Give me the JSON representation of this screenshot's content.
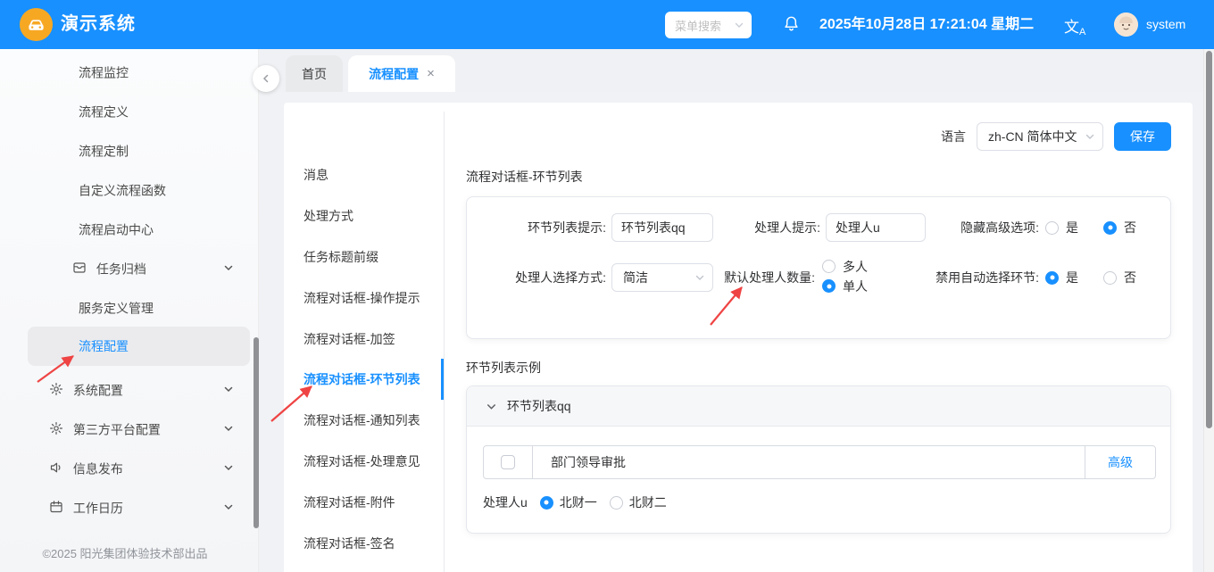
{
  "colors": {
    "accent": "#1890ff",
    "header_bg": "#1890ff",
    "logo_bg": "#f7a823",
    "arrow": "#ef4444",
    "active_menu_bg": "#ebebed"
  },
  "header": {
    "app_title": "演示系统",
    "search_placeholder": "菜单搜索",
    "datetime": "2025年10月28日 17:21:04 星期二",
    "translate_icon_text": "文",
    "translate_icon_sub": "A",
    "username": "system"
  },
  "tabs": {
    "home": "首页",
    "current": "流程配置",
    "close": "×"
  },
  "sidebar": {
    "items": [
      {
        "label": "流程监控"
      },
      {
        "label": "流程定义"
      },
      {
        "label": "流程定制"
      },
      {
        "label": "自定义流程函数"
      },
      {
        "label": "流程启动中心"
      },
      {
        "label": "任务归档"
      },
      {
        "label": "服务定义管理"
      },
      {
        "label": "流程配置",
        "active": true
      },
      {
        "label": "系统配置"
      },
      {
        "label": "第三方平台配置"
      },
      {
        "label": "信息发布"
      },
      {
        "label": "工作日历"
      }
    ],
    "footer": "©2025 阳光集团体验技术部出品"
  },
  "toolbar": {
    "language_label": "语言",
    "language_value": "zh-CN 简体中文",
    "save_label": "保存"
  },
  "settings_menu": {
    "items": [
      {
        "label": "消息"
      },
      {
        "label": "处理方式"
      },
      {
        "label": "任务标题前缀"
      },
      {
        "label": "流程对话框-操作提示"
      },
      {
        "label": "流程对话框-加签"
      },
      {
        "label": "流程对话框-环节列表",
        "active": true
      },
      {
        "label": "流程对话框-通知列表"
      },
      {
        "label": "流程对话框-处理意见"
      },
      {
        "label": "流程对话框-附件"
      },
      {
        "label": "流程对话框-签名"
      }
    ]
  },
  "form": {
    "section_title": "流程对话框-环节列表",
    "node_list_prompt": {
      "label": "环节列表提示:",
      "value": "环节列表qq"
    },
    "handler_prompt": {
      "label": "处理人提示:",
      "value": "处理人u"
    },
    "hide_advanced": {
      "label": "隐藏高级选项:",
      "yes": "是",
      "no": "否",
      "selected": "否"
    },
    "handler_select_mode": {
      "label": "处理人选择方式:",
      "value": "简洁"
    },
    "default_handler_count": {
      "label": "默认处理人数量:",
      "multi": "多人",
      "single": "单人",
      "selected": "单人"
    },
    "disable_auto_select": {
      "label": "禁用自动选择环节:",
      "yes": "是",
      "no": "否",
      "selected": "是"
    }
  },
  "example": {
    "section_title": "环节列表示例",
    "panel_title": "环节列表qq",
    "approval_text": "部门领导审批",
    "advanced_label": "高级",
    "handler_label": "处理人u",
    "option1": "北财一",
    "option2": "北财二",
    "selected": "北财一"
  }
}
